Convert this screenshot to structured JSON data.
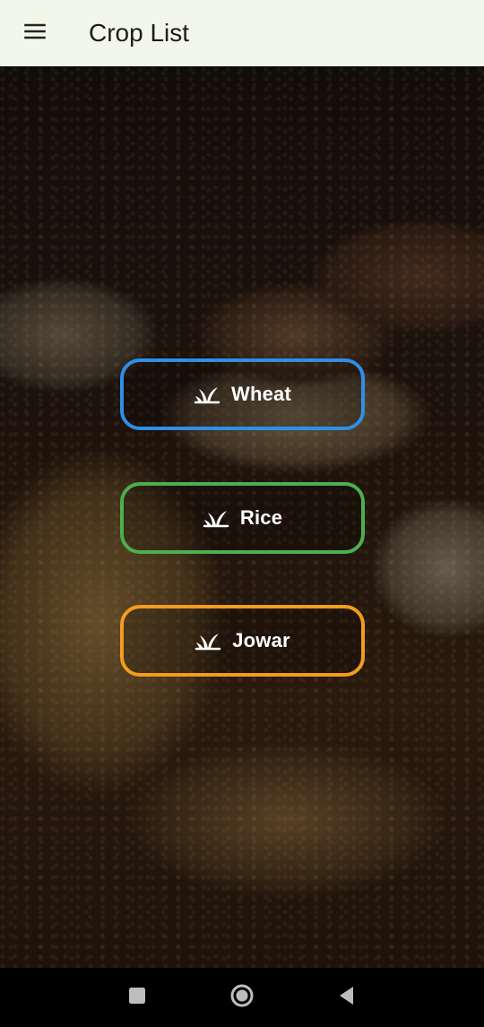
{
  "appbar": {
    "title": "Crop List",
    "menu_icon": "menu-icon"
  },
  "crops": [
    {
      "label": "Wheat",
      "icon": "sprout-icon",
      "border_color": "#2f8fe6"
    },
    {
      "label": "Rice",
      "icon": "sprout-icon",
      "border_color": "#4caf50"
    },
    {
      "label": "Jowar",
      "icon": "sprout-icon",
      "border_color": "#f39c1e"
    }
  ],
  "navbar": {
    "recent_icon": "recent-apps-icon",
    "home_icon": "home-icon",
    "back_icon": "back-icon"
  },
  "colors": {
    "appbar_bg": "#f3f7e9",
    "button_text": "#ffffff"
  }
}
